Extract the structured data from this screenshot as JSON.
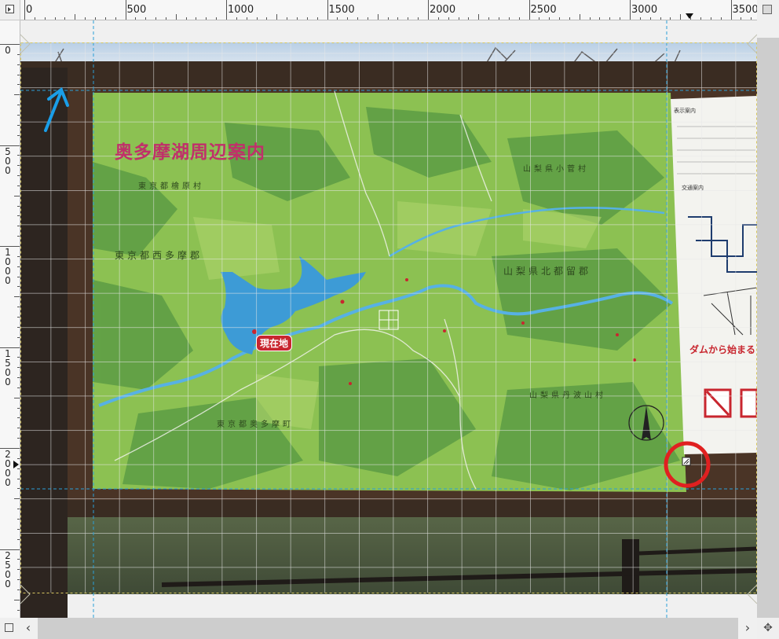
{
  "rulers": {
    "horizontal_labels": [
      "0",
      "500",
      "1000",
      "1500",
      "2000",
      "2500",
      "3000",
      "3500"
    ],
    "vertical_labels": [
      "0",
      "500",
      "1000",
      "1500",
      "2000",
      "2500"
    ]
  },
  "map": {
    "title": "奥多摩湖周辺案内",
    "current_location": "現在地",
    "labels": {
      "tokyo_hinohara": "東京都檜原村",
      "tokyo_nishitama": "東京都西多摩郡",
      "tokyo_okutama": "東京都奥多摩町",
      "yamanashi_kosuge": "山梨県小菅村",
      "yamanashi_kitatsuru": "山梨県北都留郡",
      "yamanashi_tabayama": "山梨県丹波山村"
    },
    "legend_title": "表示案内",
    "traffic_title": "交通案内",
    "dam_banner": "ダムから始まる"
  },
  "colors": {
    "map_green": "#8cc152",
    "dark_green": "#4e8c3a",
    "lake_blue": "#3d9bd6",
    "frame_brown": "#4a3426",
    "guide_cyan": "#2aa0d8",
    "annotation_red": "#e02020",
    "arrow_blue": "#1a9ee8"
  },
  "icons": {
    "ruler_toggle": "ruler-toggle-icon",
    "zoom_fit": "zoom-fit-icon",
    "quick_mask": "quick-mask-icon",
    "navigate": "navigate-icon"
  }
}
